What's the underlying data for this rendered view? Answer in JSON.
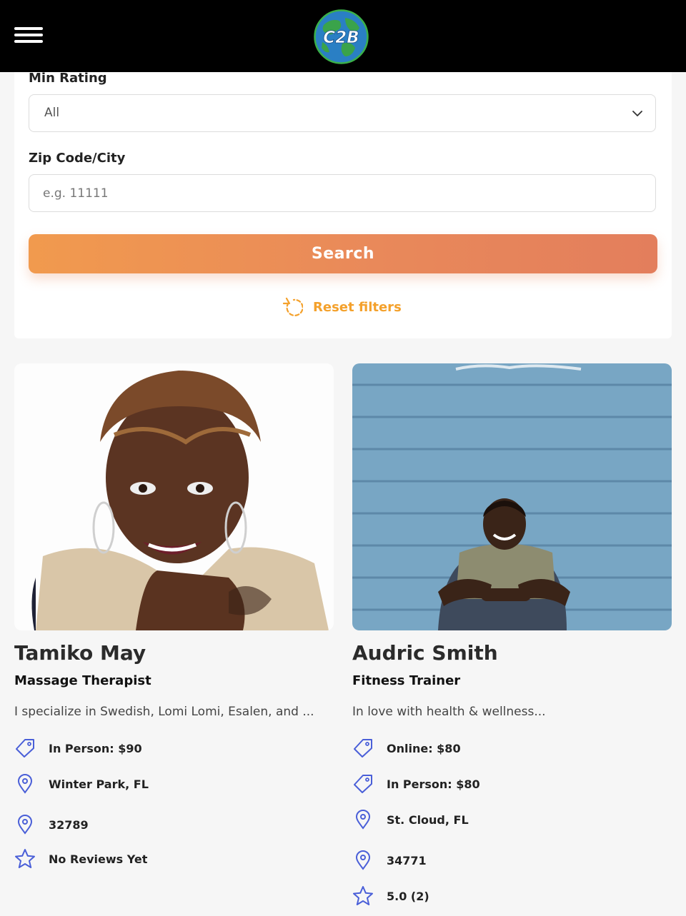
{
  "header": {
    "logo_text": "C2B"
  },
  "filters": {
    "min_rating_label": "Min Rating",
    "min_rating_value": "All",
    "zip_label": "Zip Code/City",
    "zip_placeholder": "e.g. 11111",
    "search_label": "Search",
    "reset_label": "Reset filters"
  },
  "colors": {
    "accent_orange": "#f4a12c",
    "button_gradient_start": "#f19a4e",
    "button_gradient_end": "#e37e5c",
    "icon_blue": "#4a5fd8"
  },
  "providers": [
    {
      "name": "Tamiko May",
      "title": "Massage Therapist",
      "bio": "I specialize in Swedish, Lomi Lomi, Esalen, and ...",
      "details": [
        {
          "icon": "price-tag-icon",
          "text": "In Person: $90"
        },
        {
          "icon": "location-pin-icon",
          "text": "Winter Park, FL"
        },
        {
          "icon": "location-pin-icon",
          "text": "32789"
        },
        {
          "icon": "star-icon",
          "text": "No Reviews Yet"
        }
      ]
    },
    {
      "name": "Audric Smith",
      "title": "Fitness Trainer",
      "bio": "In love with health & wellness...",
      "details": [
        {
          "icon": "price-tag-icon",
          "text": "Online: $80"
        },
        {
          "icon": "price-tag-icon",
          "text": "In Person: $80"
        },
        {
          "icon": "location-pin-icon",
          "text": "St. Cloud, FL"
        },
        {
          "icon": "location-pin-icon",
          "text": "34771"
        },
        {
          "icon": "star-icon",
          "text": "5.0 (2)"
        }
      ]
    }
  ]
}
